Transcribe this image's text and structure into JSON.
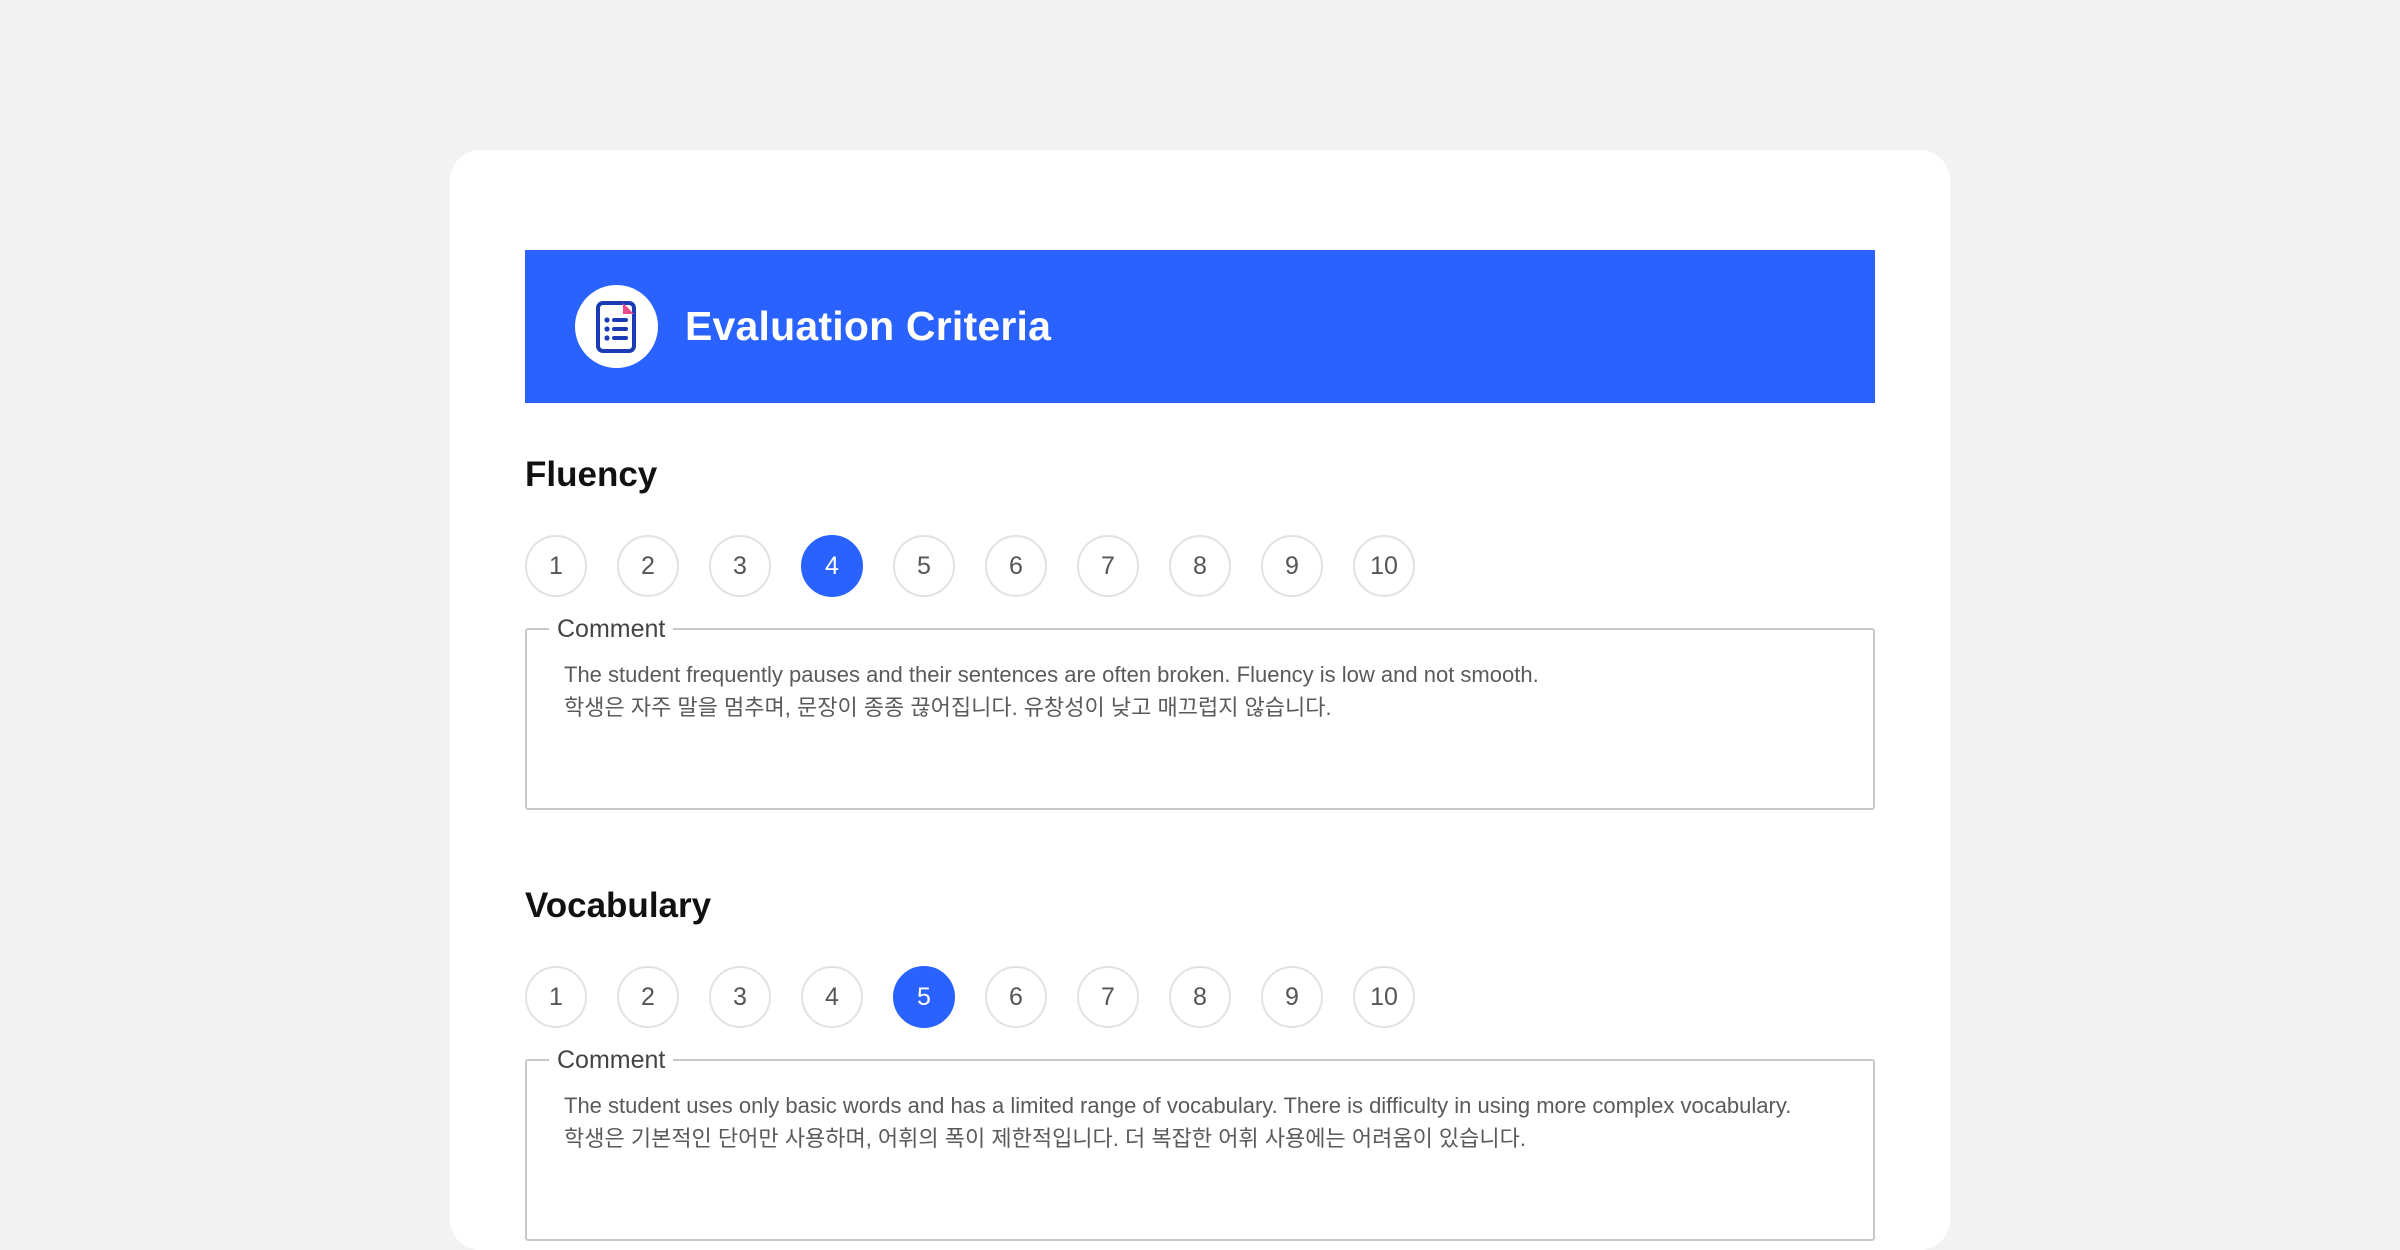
{
  "header": {
    "title": "Evaluation Criteria",
    "icon": "clipboard-list-icon"
  },
  "sections": [
    {
      "title": "Fluency",
      "scores": [
        "1",
        "2",
        "3",
        "4",
        "5",
        "6",
        "7",
        "8",
        "9",
        "10"
      ],
      "selected": "4",
      "comment_label": "Comment",
      "comment_lines": [
        "The student frequently pauses and their sentences are often broken. Fluency is low and not smooth.",
        "학생은 자주 말을 멈추며, 문장이 종종 끊어집니다. 유창성이 낮고 매끄럽지 않습니다."
      ]
    },
    {
      "title": "Vocabulary",
      "scores": [
        "1",
        "2",
        "3",
        "4",
        "5",
        "6",
        "7",
        "8",
        "9",
        "10"
      ],
      "selected": "5",
      "comment_label": "Comment",
      "comment_lines": [
        "The student uses only basic words and has a limited range of vocabulary. There is difficulty in using more complex vocabulary.",
        "학생은 기본적인 단어만 사용하며, 어휘의 폭이 제한적입니다. 더 복잡한 어휘 사용에는 어려움이 있습니다."
      ]
    }
  ],
  "colors": {
    "accent": "#2962ff",
    "background": "#f2f2f2",
    "card": "#ffffff"
  }
}
